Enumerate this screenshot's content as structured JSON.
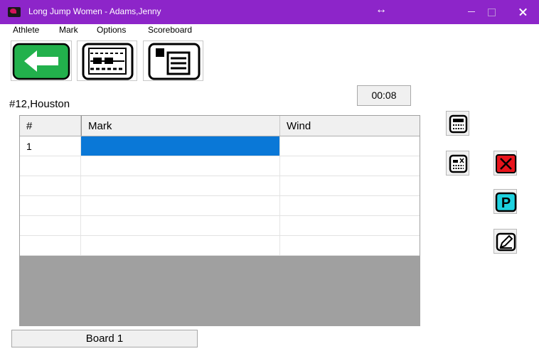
{
  "window": {
    "title": "Long Jump Women - Adams,Jenny",
    "resize_glyph": "↔",
    "accent_color": "#8d25c9"
  },
  "menu": [
    "Athlete",
    "Mark",
    "Options",
    "Scoreboard"
  ],
  "toolbar": {
    "back_icon": "left-arrow-icon",
    "board_icon": "mark-board-icon",
    "athlete_icon": "athlete-list-icon"
  },
  "athlete": {
    "label": "#12,Houston"
  },
  "timer": "00:08",
  "grid": {
    "columns": [
      "#",
      "Mark",
      "Wind"
    ],
    "rows": [
      {
        "num": "1",
        "mark": "",
        "wind": ""
      },
      {
        "num": "",
        "mark": "",
        "wind": ""
      },
      {
        "num": "",
        "mark": "",
        "wind": ""
      },
      {
        "num": "",
        "mark": "",
        "wind": ""
      },
      {
        "num": "",
        "mark": "",
        "wind": ""
      },
      {
        "num": "",
        "mark": "",
        "wind": ""
      }
    ],
    "selected_color": "#0a78d7"
  },
  "side_buttons": {
    "keypad": "keypad-icon",
    "keypad_clear": "keypad-clear-icon",
    "foul": "red-x-icon",
    "pass_letter": "P",
    "edit": "edit-pencil-icon"
  },
  "board_button": "Board 1"
}
